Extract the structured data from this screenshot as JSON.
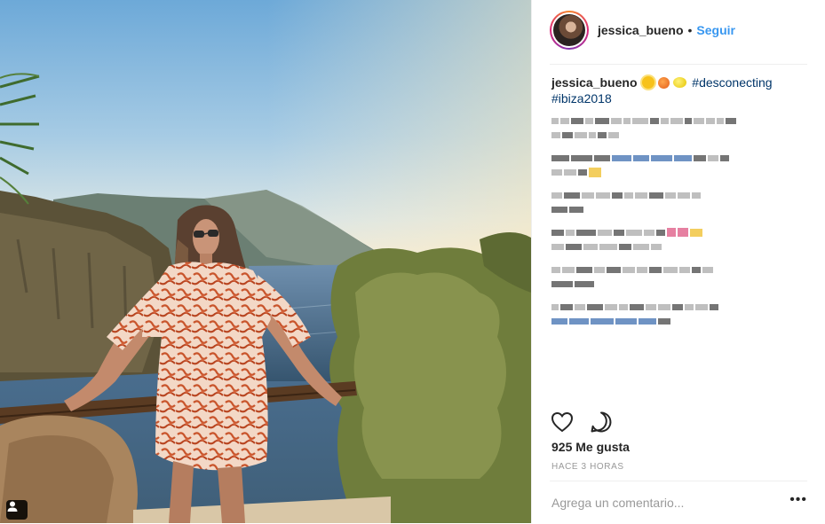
{
  "post": {
    "username": "jessica_bueno",
    "follow_label": "Seguir",
    "separator": "•",
    "caption": {
      "username": "jessica_bueno",
      "emojis": [
        "sun",
        "peach",
        "lemon"
      ],
      "hashtags": [
        "#desconecting",
        "#ibiza2018"
      ]
    },
    "comments_blurred": 6,
    "likes": "925 Me gusta",
    "timestamp": "HACE 3 HORAS",
    "comment_placeholder": "Agrega un comentario...",
    "more_label": "•••"
  },
  "icons": {
    "like": "heart-icon",
    "comment": "comment-bubble-icon",
    "user_tag": "user-tag-icon",
    "more": "more-options-icon"
  },
  "colors": {
    "link_blue": "#3897f0",
    "hashtag": "#003569",
    "text": "#262626",
    "muted": "#999999",
    "divider": "#efefef"
  }
}
